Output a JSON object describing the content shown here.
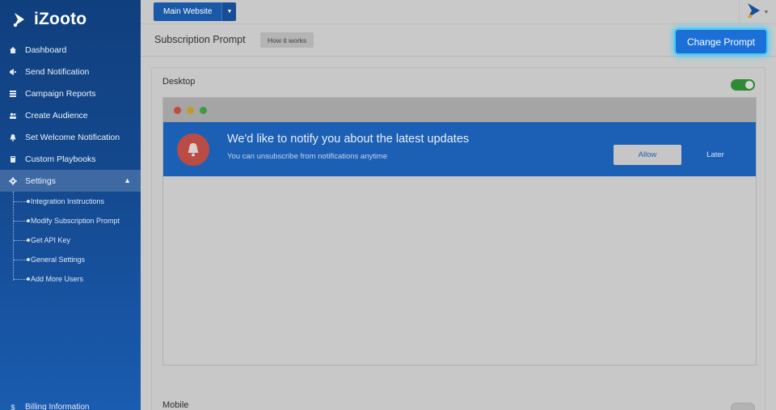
{
  "brand": {
    "name": "iZooto"
  },
  "sidebar": {
    "items": [
      {
        "label": "Dashboard",
        "icon": "home-icon"
      },
      {
        "label": "Send Notification",
        "icon": "megaphone-icon"
      },
      {
        "label": "Campaign Reports",
        "icon": "list-icon"
      },
      {
        "label": "Create Audience",
        "icon": "users-icon"
      },
      {
        "label": "Set Welcome Notification",
        "icon": "bell-icon"
      },
      {
        "label": "Custom Playbooks",
        "icon": "book-icon"
      },
      {
        "label": "Settings",
        "icon": "gear-icon"
      }
    ],
    "settings_sub": [
      {
        "label": "Integration Instructions"
      },
      {
        "label": "Modify Subscription Prompt"
      },
      {
        "label": "Get API Key"
      },
      {
        "label": "General Settings"
      },
      {
        "label": "Add More Users"
      }
    ],
    "billing_label": "Billing Information"
  },
  "topbar": {
    "site_label": "Main Website"
  },
  "header": {
    "title": "Subscription Prompt",
    "how_label": "How it works",
    "change_label": "Change Prompt"
  },
  "desktop": {
    "label": "Desktop",
    "enabled": true,
    "prompt_title": "We'd like to notify you about the latest updates",
    "prompt_subtitle": "You can unsubscribe from notifications anytime",
    "allow_label": "Allow",
    "later_label": "Later"
  },
  "mobile": {
    "label": "Mobile",
    "enabled": false
  },
  "colors": {
    "accent": "#1b6fd6",
    "sidebar": "#14498f",
    "banner": "#1c60b5",
    "bell": "#bb4c43"
  }
}
